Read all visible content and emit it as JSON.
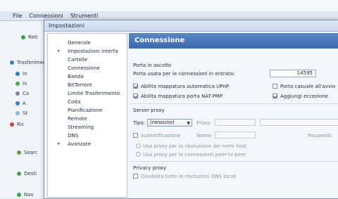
{
  "menubar": {
    "items": [
      "File",
      "Connessioni",
      "Strumenti"
    ]
  },
  "leftpane": {
    "items": [
      "Reti",
      "Trasferimenti",
      "In",
      "In",
      "Ca",
      "A",
      "St",
      "Ric",
      "Searc",
      "Desti",
      "Nav"
    ]
  },
  "dialog": {
    "title": "Impostazioni"
  },
  "tree": {
    "items": [
      "Generale",
      "Impostazioni interfa",
      "Cartelle",
      "Connessione",
      "Banda",
      "BitTorrent",
      "Limite Trasferimento",
      "Coda",
      "Pianificazione",
      "Remote",
      "Streaming",
      "DNS",
      "Avanzate"
    ]
  },
  "content": {
    "section_title": "Connessione",
    "listen_port_header": "Porta in ascolto",
    "listen_port_label": "Porta usata per le connessioni in entrata:",
    "listen_port_value": "14595",
    "upnp_label": "Abilita mappatura automatica UPnP",
    "random_port_label": "Porta casuale all'avvio",
    "natpmp_label": "Abilita mappatura porta NAT-PMP",
    "firewall_label": "Aggiungi eccezione",
    "proxy_header": "Server proxy",
    "proxy_type_label": "Tipo:",
    "proxy_type_value": "(nessuno)",
    "proxy_host_label": "Proxy:",
    "proxy_auth_label": "Autentificazione",
    "proxy_user_label": "Nome:",
    "proxy_pass_label": "Password:",
    "proxy_hostname_lookup": "Usa proxy per la risoluzione dei nomi host",
    "proxy_p2p_label": "Usa proxy per le connessioni peer-to-peer",
    "privacy_header": "Privacy proxy",
    "privacy_dns_label": "Disabilita tutte le risoluzioni DNS locali"
  }
}
